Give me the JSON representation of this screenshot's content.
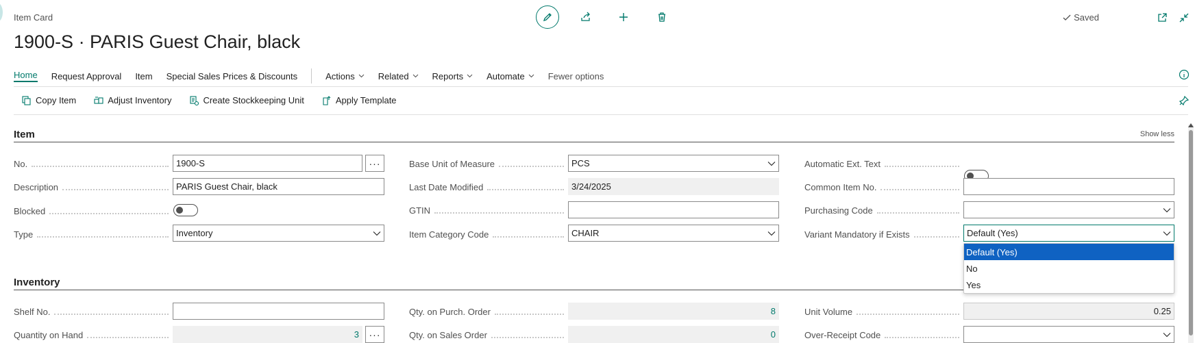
{
  "header": {
    "page_type": "Item Card",
    "title": "1900-S · PARIS Guest Chair, black",
    "saved_label": "Saved"
  },
  "nav": {
    "items": [
      {
        "label": "Home",
        "active": true
      },
      {
        "label": "Request Approval"
      },
      {
        "label": "Item"
      },
      {
        "label": "Special Sales Prices & Discounts"
      }
    ],
    "menus": [
      {
        "label": "Actions"
      },
      {
        "label": "Related"
      },
      {
        "label": "Reports"
      },
      {
        "label": "Automate"
      }
    ],
    "fewer_options": "Fewer options"
  },
  "actions": [
    {
      "label": "Copy Item",
      "icon": "copy-icon"
    },
    {
      "label": "Adjust Inventory",
      "icon": "inventory-icon"
    },
    {
      "label": "Create Stockkeeping Unit",
      "icon": "stockkeeping-icon"
    },
    {
      "label": "Apply Template",
      "icon": "template-icon"
    }
  ],
  "item_section": {
    "title": "Item",
    "show_less": "Show less",
    "col1": {
      "no_label": "No.",
      "no_value": "1900-S",
      "description_label": "Description",
      "description_value": "PARIS Guest Chair, black",
      "blocked_label": "Blocked",
      "type_label": "Type",
      "type_value": "Inventory"
    },
    "col2": {
      "base_uom_label": "Base Unit of Measure",
      "base_uom_value": "PCS",
      "last_modified_label": "Last Date Modified",
      "last_modified_value": "3/24/2025",
      "gtin_label": "GTIN",
      "gtin_value": "",
      "category_label": "Item Category Code",
      "category_value": "CHAIR"
    },
    "col3": {
      "auto_ext_label": "Automatic Ext. Text",
      "common_no_label": "Common Item No.",
      "common_no_value": "",
      "purchasing_label": "Purchasing Code",
      "purchasing_value": "",
      "variant_label": "Variant Mandatory if Exists",
      "variant_value": "Default (Yes)"
    }
  },
  "variant_dropdown": {
    "options": [
      "Default (Yes)",
      "No",
      "Yes"
    ],
    "selected_index": 0
  },
  "inventory_section": {
    "title": "Inventory",
    "shelf_label": "Shelf No.",
    "shelf_value": "",
    "qoh_label": "Quantity on Hand",
    "qoh_value": "3",
    "qpo_label": "Qty. on Purch. Order",
    "qpo_value": "8",
    "qso_label": "Qty. on Sales Order",
    "qso_value": "0",
    "unit_volume_label": "Unit Volume",
    "unit_volume_value": "0.25",
    "over_receipt_label": "Over-Receipt Code",
    "over_receipt_value": ""
  },
  "colors": {
    "accent": "#00796b",
    "selected": "#0f62c2"
  }
}
